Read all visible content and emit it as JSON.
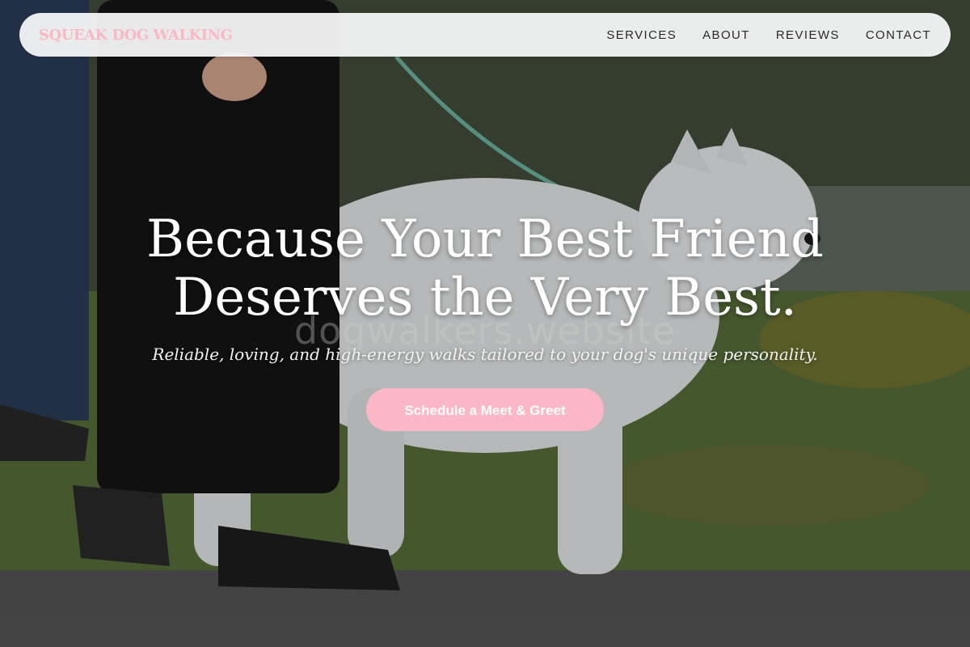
{
  "nav": {
    "logo": "SQUEAK DOG WALKING",
    "links": [
      "SERVICES",
      "ABOUT",
      "REVIEWS",
      "CONTACT"
    ]
  },
  "hero": {
    "headline_line1": "Because Your Best Friend",
    "headline_line2": "Deserves the Very Best.",
    "subheadline": "Reliable, loving, and high-energy walks tailored to your dog's unique personality.",
    "cta_label": "Schedule a Meet & Greet",
    "watermark": "dogwalkers.website",
    "background_description_icon": "hero-photo-dog-walk"
  },
  "colors": {
    "accent": "#fbb7c5",
    "logo": "#f8b8c6",
    "nav_text": "#2a2a2a"
  }
}
